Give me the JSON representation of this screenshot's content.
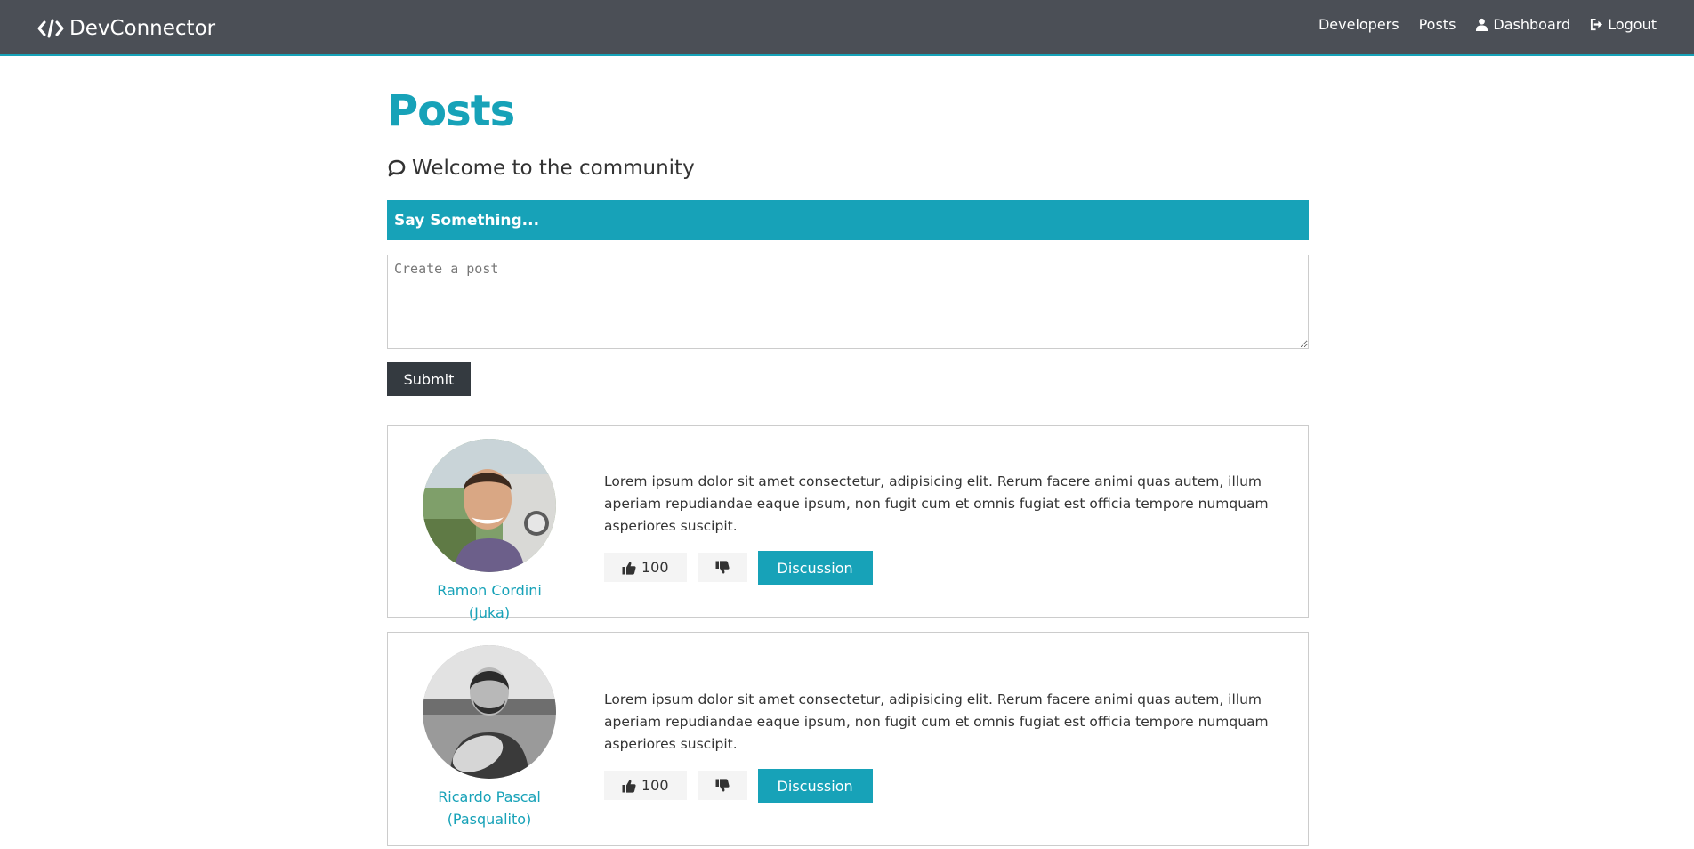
{
  "nav": {
    "brand": "DevConnector",
    "links": [
      {
        "label": "Developers"
      },
      {
        "label": "Posts"
      },
      {
        "label": "Dashboard"
      },
      {
        "label": "Logout"
      }
    ]
  },
  "page": {
    "title": "Posts",
    "lead": "Welcome to the community"
  },
  "post_form": {
    "header": "Say Something...",
    "placeholder": "Create a post",
    "value": "",
    "submit_label": "Submit"
  },
  "posts": [
    {
      "author": "Ramon Cordini (Juka)",
      "text": "Lorem ipsum dolor sit amet consectetur, adipisicing elit. Rerum facere animi quas autem, illum aperiam repudiandae eaque ipsum, non fugit cum et omnis fugiat est officia tempore numquam asperiores suscipit.",
      "likes": "100",
      "discussion_label": "Discussion"
    },
    {
      "author": "Ricardo Pascal (Pasqualito)",
      "text": "Lorem ipsum dolor sit amet consectetur, adipisicing elit. Rerum facere animi quas autem, illum aperiam repudiandae eaque ipsum, non fugit cum et omnis fugiat est officia tempore numquam asperiores suscipit.",
      "likes": "100",
      "discussion_label": "Discussion"
    }
  ],
  "icons": {
    "brand": "code-icon",
    "dashboard": "user-icon",
    "logout": "sign-out-icon",
    "lead": "comment-icon",
    "like": "thumbs-up-icon",
    "unlike": "thumbs-down-icon"
  },
  "colors": {
    "navbar": "#4b4f56",
    "primary": "#17a2b8",
    "dark": "#343a40",
    "light": "#f4f4f4"
  }
}
